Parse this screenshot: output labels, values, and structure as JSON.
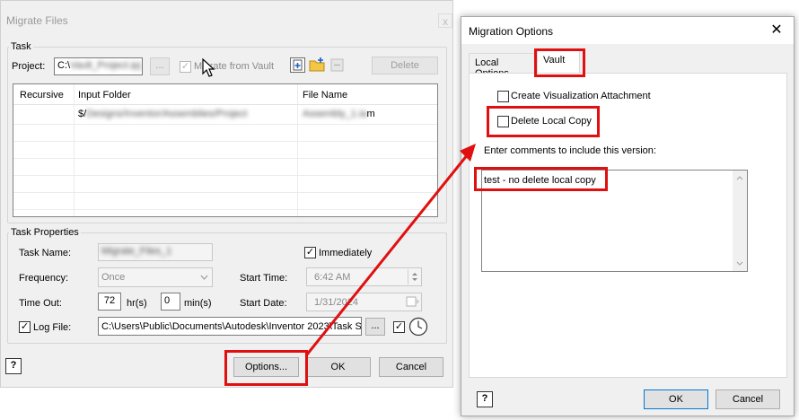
{
  "migrate_files": {
    "title": "Migrate Files",
    "close": "x",
    "task_group_label": "Task",
    "project_label": "Project:",
    "project_value": "C:\\",
    "project_value_blurred": "Vault_Project.ipj",
    "browse_label": "...",
    "migrate_from_vault_label": "Migrate from Vault",
    "migrate_from_vault_checked": "✓",
    "delete_label": "Delete",
    "table": {
      "headers": [
        "Recursive",
        "Input Folder",
        "File Name"
      ],
      "row1": {
        "recursive": "",
        "input_folder": "$/",
        "input_folder_blurred": "Designs/Inventor/Assemblies/Project",
        "file_name": "m",
        "file_name_blurred": "Assembly_1.ia"
      }
    },
    "task_properties_label": "Task Properties",
    "task_name_label": "Task Name:",
    "task_name_value_blurred": "Migrate_Files_1",
    "immediately_label": "Immediately",
    "immediately_checked": "✓",
    "frequency_label": "Frequency:",
    "frequency_value": "Once",
    "start_time_label": "Start Time:",
    "start_time_value": "6:42 AM",
    "time_out_label": "Time Out:",
    "hours_value": "72",
    "hours_unit": "hr(s)",
    "minutes_value": "0",
    "minutes_unit": "min(s)",
    "start_date_label": "Start Date:",
    "start_date_value": "1/31/2024",
    "log_file_label": "Log File:",
    "log_file_checked": "✓",
    "log_file_value": "C:\\Users\\Public\\Documents\\Autodesk\\Inventor 2023\\Task S",
    "log_browse_label": "...",
    "log_extra_checked": "✓",
    "help_icon_glyph": "?",
    "options_label": "Options...",
    "ok_label": "OK",
    "cancel_label": "Cancel"
  },
  "migration_options": {
    "title": "Migration Options",
    "close": "✕",
    "tabs": [
      "Local Options",
      "Vault"
    ],
    "create_visualization_label": "Create Visualization Attachment",
    "delete_local_copy_label": "Delete Local Copy",
    "comments_label": "Enter comments to include this version:",
    "comments_value": "test - no delete local copy",
    "help_icon_glyph": "?",
    "ok_label": "OK",
    "cancel_label": "Cancel"
  },
  "colors": {
    "highlight": "#e01010",
    "accent": "#0078d7"
  }
}
